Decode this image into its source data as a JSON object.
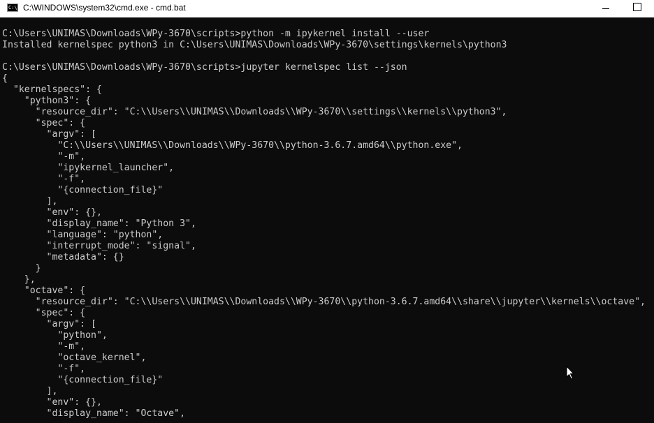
{
  "window": {
    "title": "C:\\WINDOWS\\system32\\cmd.exe - cmd.bat",
    "icon": "cmd-icon",
    "icon_text": "C:\\",
    "controls": [
      "minimize-icon",
      "maximize-icon"
    ]
  },
  "console": {
    "background": "#0c0c0c",
    "foreground": "#cccccc",
    "lines": [
      "C:\\Users\\UNIMAS\\Downloads\\WPy-3670\\scripts>python -m ipykernel install --user",
      "Installed kernelspec python3 in C:\\Users\\UNIMAS\\Downloads\\WPy-3670\\settings\\kernels\\python3",
      "",
      "C:\\Users\\UNIMAS\\Downloads\\WPy-3670\\scripts>jupyter kernelspec list --json",
      "{",
      "  \"kernelspecs\": {",
      "    \"python3\": {",
      "      \"resource_dir\": \"C:\\\\Users\\\\UNIMAS\\\\Downloads\\\\WPy-3670\\\\settings\\\\kernels\\\\python3\",",
      "      \"spec\": {",
      "        \"argv\": [",
      "          \"C:\\\\Users\\\\UNIMAS\\\\Downloads\\\\WPy-3670\\\\python-3.6.7.amd64\\\\python.exe\",",
      "          \"-m\",",
      "          \"ipykernel_launcher\",",
      "          \"-f\",",
      "          \"{connection_file}\"",
      "        ],",
      "        \"env\": {},",
      "        \"display_name\": \"Python 3\",",
      "        \"language\": \"python\",",
      "        \"interrupt_mode\": \"signal\",",
      "        \"metadata\": {}",
      "      }",
      "    },",
      "    \"octave\": {",
      "      \"resource_dir\": \"C:\\\\Users\\\\UNIMAS\\\\Downloads\\\\WPy-3670\\\\python-3.6.7.amd64\\\\share\\\\jupyter\\\\kernels\\\\octave\",",
      "      \"spec\": {",
      "        \"argv\": [",
      "          \"python\",",
      "          \"-m\",",
      "          \"octave_kernel\",",
      "          \"-f\",",
      "          \"{connection_file}\"",
      "        ],",
      "        \"env\": {},",
      "        \"display_name\": \"Octave\","
    ]
  },
  "cursor": {
    "icon": "mouse-pointer-icon"
  }
}
